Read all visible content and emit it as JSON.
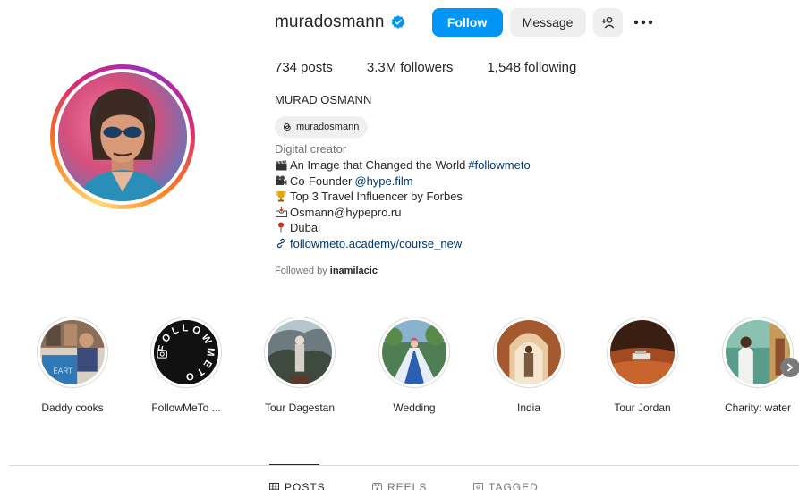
{
  "profile": {
    "username": "muradosmann",
    "follow_label": "Follow",
    "message_label": "Message",
    "add_user_label": "+ɤ",
    "stats": {
      "posts_count": "734",
      "posts_label": "posts",
      "followers_count": "3.3M",
      "followers_label": "followers",
      "following_count": "1,548",
      "following_label": "following"
    },
    "full_name": "MURAD OSMANN",
    "threads_handle": "muradosmann",
    "category": "Digital creator",
    "bio": {
      "line1_text": "An Image that Changed the World ",
      "line1_hashtag": "#followmeto",
      "line2_text": "Co-Founder ",
      "line2_mention": "@hype.film",
      "line3_text": "Top 3 Travel Influencer by Forbes",
      "line4_text": "Osmann@hypepro.ru",
      "line5_text": "Dubai",
      "link_text": "followmeto.academy/course_new"
    },
    "followed_by_prefix": "Followed by ",
    "followed_by_user": "inamilacic"
  },
  "highlights": [
    {
      "label": "Daddy cooks"
    },
    {
      "label": "FollowMeTo ..."
    },
    {
      "label": "Tour Dagestan"
    },
    {
      "label": "Wedding"
    },
    {
      "label": "India"
    },
    {
      "label": "Tour Jordan"
    },
    {
      "label": "Charity: water"
    }
  ],
  "followmeto_ring_text": "FOLLOWMETO",
  "tabs": [
    {
      "label": "POSTS",
      "icon": "grid-icon"
    },
    {
      "label": "REELS",
      "icon": "reels-icon"
    },
    {
      "label": "TAGGED",
      "icon": "tagged-icon"
    }
  ],
  "colors": {
    "follow_button": "#0095f6",
    "secondary_button": "#efefef",
    "link": "#00376b",
    "muted_text": "#737373"
  }
}
